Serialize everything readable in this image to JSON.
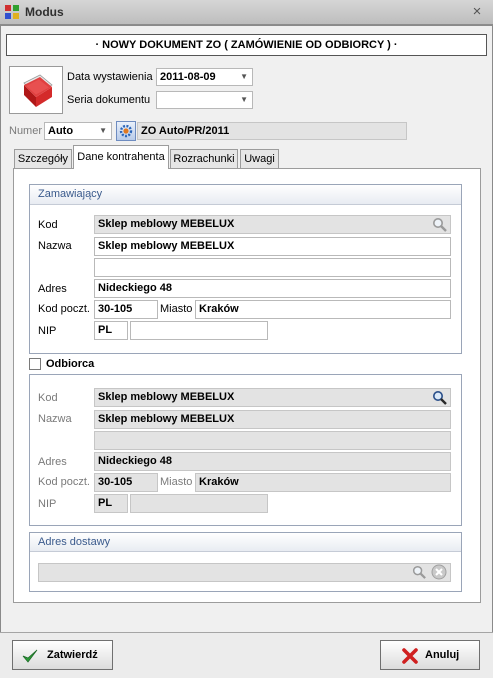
{
  "window": {
    "title": "Modus",
    "close_glyph": "×"
  },
  "header": {
    "text": "· NOWY DOKUMENT ZO ( ZAMÓWIENIE OD ODBIORCY ) ·"
  },
  "doc_fields": {
    "date_label": "Data wystawienia",
    "date_value": "2011-08-09",
    "series_label": "Seria dokumentu",
    "series_value": ""
  },
  "numer": {
    "label": "Numer",
    "mode": "Auto",
    "value": "ZO Auto/PR/2011"
  },
  "tabs": [
    {
      "label": "Szczegóły"
    },
    {
      "label": "Dane kontrahenta"
    },
    {
      "label": "Rozrachunki"
    },
    {
      "label": "Uwagi"
    }
  ],
  "zamawiajacy": {
    "title": "Zamawiający",
    "kod_label": "Kod",
    "kod": "Sklep meblowy MEBELUX",
    "nazwa_label": "Nazwa",
    "nazwa": "Sklep meblowy MEBELUX",
    "nazwa2": "",
    "adres_label": "Adres",
    "adres": "Nideckiego 48",
    "kod_pocz_label": "Kod poczt.",
    "kod_pocz": "30-105",
    "miasto_label": "Miasto",
    "miasto": "Kraków",
    "nip_label": "NIP",
    "nip_prefix": "PL",
    "nip": ""
  },
  "odbiorca": {
    "checkbox_label": "Odbiorca",
    "checked": false,
    "kod_label": "Kod",
    "kod": "Sklep meblowy MEBELUX",
    "nazwa_label": "Nazwa",
    "nazwa": "Sklep meblowy MEBELUX",
    "nazwa2": "",
    "adres_label": "Adres",
    "adres": "Nideckiego 48",
    "kod_pocz_label": "Kod poczt.",
    "kod_pocz": "30-105",
    "miasto_label": "Miasto",
    "miasto": "Kraków",
    "nip_label": "NIP",
    "nip_prefix": "PL",
    "nip": ""
  },
  "adres_dostawy": {
    "title": "Adres dostawy",
    "value": ""
  },
  "buttons": {
    "confirm": "Zatwierdź",
    "cancel": "Anuluj"
  },
  "colors": {
    "group_title": "#3a5a8c",
    "confirm_check": "#2e9b3a",
    "cancel_x": "#d02020"
  }
}
